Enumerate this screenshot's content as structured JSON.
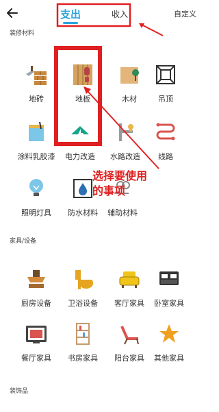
{
  "header": {
    "back_icon": "back-arrow-icon",
    "tab_expense": "支出",
    "tab_income": "收入",
    "custom": "自定义"
  },
  "sections": {
    "renovation": "装修材料",
    "furniture": "家具/设备",
    "decor": "装饰品"
  },
  "renovation_items": [
    {
      "label": "地砖",
      "icon": "floor-tile-icon"
    },
    {
      "label": "地板",
      "icon": "wood-floor-icon"
    },
    {
      "label": "木材",
      "icon": "timber-icon"
    },
    {
      "label": "吊顶",
      "icon": "ceiling-icon"
    },
    {
      "label": "涂料乳胶漆",
      "icon": "paint-bucket-icon"
    },
    {
      "label": "电力改造",
      "icon": "electric-icon"
    },
    {
      "label": "水路改造",
      "icon": "water-pipe-icon"
    },
    {
      "label": "线路",
      "icon": "wiring-icon"
    },
    {
      "label": "照明灯具",
      "icon": "light-bulb-icon"
    },
    {
      "label": "防水材料",
      "icon": "waterproof-icon"
    },
    {
      "label": "辅助材料",
      "icon": "tools-icon"
    }
  ],
  "furniture_items": [
    {
      "label": "厨房设备",
      "icon": "range-hood-icon"
    },
    {
      "label": "卫浴设备",
      "icon": "toilet-icon"
    },
    {
      "label": "客厅家具",
      "icon": "sofa-icon"
    },
    {
      "label": "卧室家具",
      "icon": "bed-icon"
    },
    {
      "label": "餐厅家具",
      "icon": "microwave-icon"
    },
    {
      "label": "书房家具",
      "icon": "bookshelf-icon"
    },
    {
      "label": "阳台家具",
      "icon": "lounge-chair-icon"
    },
    {
      "label": "其他家具",
      "icon": "star-icon"
    }
  ],
  "annotation": {
    "line1": "选择要使用",
    "line2": "的事项"
  },
  "colors": {
    "accent": "#2ba4de",
    "annotation": "#e02020"
  }
}
